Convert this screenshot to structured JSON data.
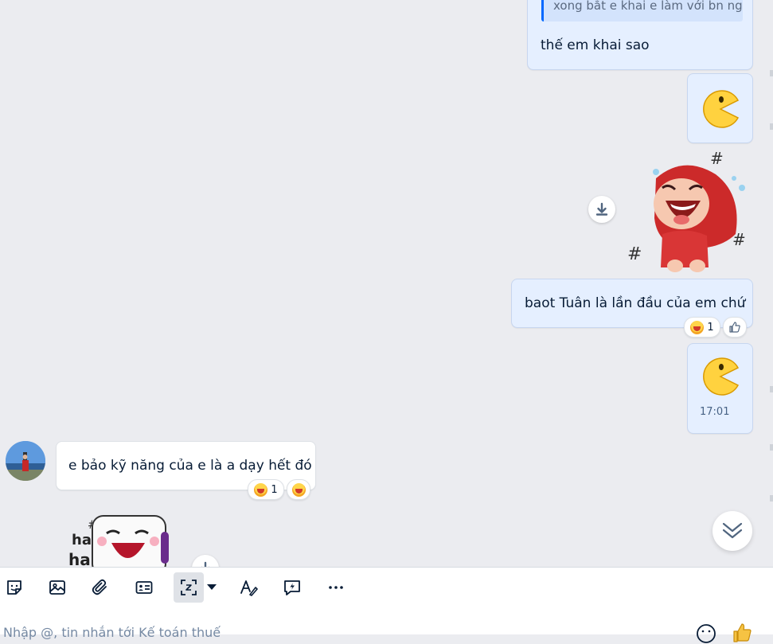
{
  "messages": {
    "quote_text": "xong bắt e khai e làm với bn ng",
    "reply_text": "thế em khai sao",
    "outgoing_text": "baot Tuân là lần đầu của em chứ",
    "outgoing_reaction_count": "1",
    "sticker_time": "17:01",
    "incoming_text": "e bảo kỹ năng của e là a dạy hết đó",
    "incoming_reaction_count": "1",
    "sticker_caption": "ha ha"
  },
  "composer": {
    "placeholder": "Nhập @, tin nhắn tới Kế toán thuế"
  },
  "icons": {
    "toolbar": [
      "sticker-icon",
      "image-icon",
      "attach-icon",
      "contact-card-icon",
      "screenshot-icon",
      "dropdown-icon",
      "text-format-icon",
      "quick-message-icon",
      "more-icon"
    ],
    "composer": [
      "emoji-icon",
      "like-icon"
    ]
  },
  "colors": {
    "background": "#ebecf0",
    "outgoing_bubble": "#e5efff",
    "incoming_bubble": "#ffffff",
    "accent": "#0068ff"
  }
}
